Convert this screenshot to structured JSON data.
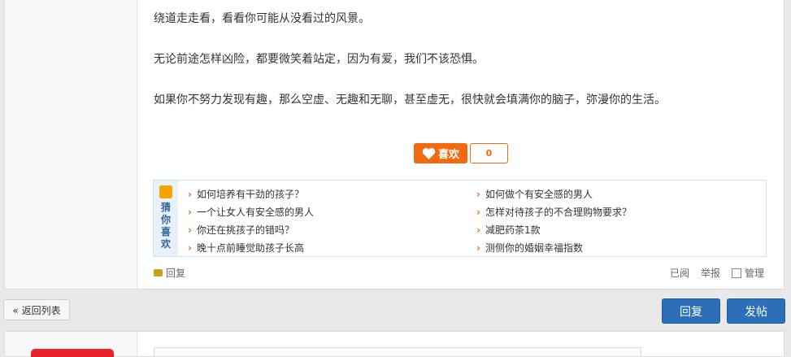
{
  "content": {
    "paragraphs": [
      "绕道走走看，看看你可能从没看过的风景。",
      "无论前途怎样凶险，都要微笑着站定，因为有爱，我们不该恐惧。",
      "如果你不努力发现有趣，那么空虚、无趣和无聊，甚至虚无，很快就会填满你的脑子，弥漫你的生活。"
    ]
  },
  "like": {
    "label": "喜欢",
    "count": "0",
    "icon": "heart-icon",
    "color": "#f26a10"
  },
  "guess": {
    "title_chars": [
      "猜",
      "你",
      "喜",
      "欢"
    ],
    "left_items": [
      "如何培养有干劲的孩子？",
      "一个让女人有安全感的男人",
      "你还在挑孩子的错吗？",
      "晚十点前睡觉助孩子长高"
    ],
    "right_items": [
      "如何做个有安全感的男人",
      "怎样对待孩子的不合理购物要求？",
      "减肥药茶1款",
      "测侧你的婚姻幸福指数"
    ]
  },
  "post_footer": {
    "reply": "回复",
    "read": "已阅",
    "report": "举报",
    "manage": "管理"
  },
  "actions": {
    "back": "« 返回列表",
    "reply": "回复",
    "new_post": "发帖",
    "primary_color": "#2a6fb8"
  }
}
